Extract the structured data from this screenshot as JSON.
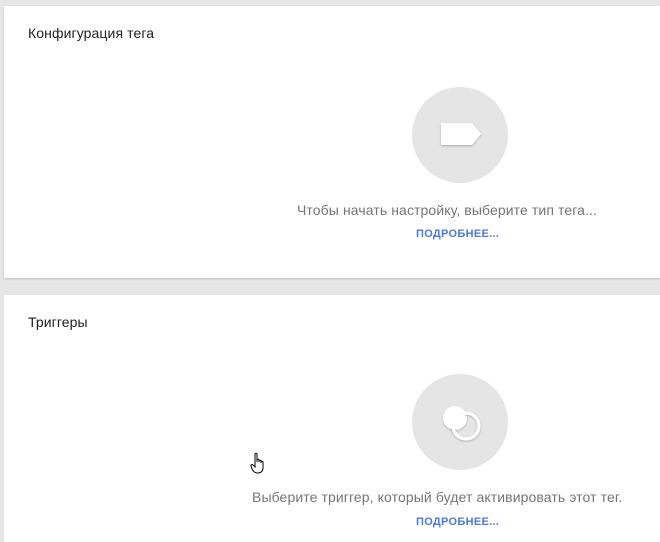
{
  "tag_config": {
    "title": "Конфигурация тега",
    "description": "Чтобы начать настройку, выберите тип тега...",
    "learn_more": "ПОДРОБНЕЕ...",
    "icon": "tag-icon"
  },
  "triggers": {
    "title": "Триггеры",
    "description": "Выберите триггер, который будет активировать этот тег.",
    "learn_more": "ПОДРОБНЕЕ...",
    "icon": "trigger-icon"
  },
  "colors": {
    "background": "#e6e6e6",
    "card": "#ffffff",
    "icon_circle": "#e5e5e5",
    "link": "#4a7bd9",
    "secondary_text": "#757575"
  }
}
